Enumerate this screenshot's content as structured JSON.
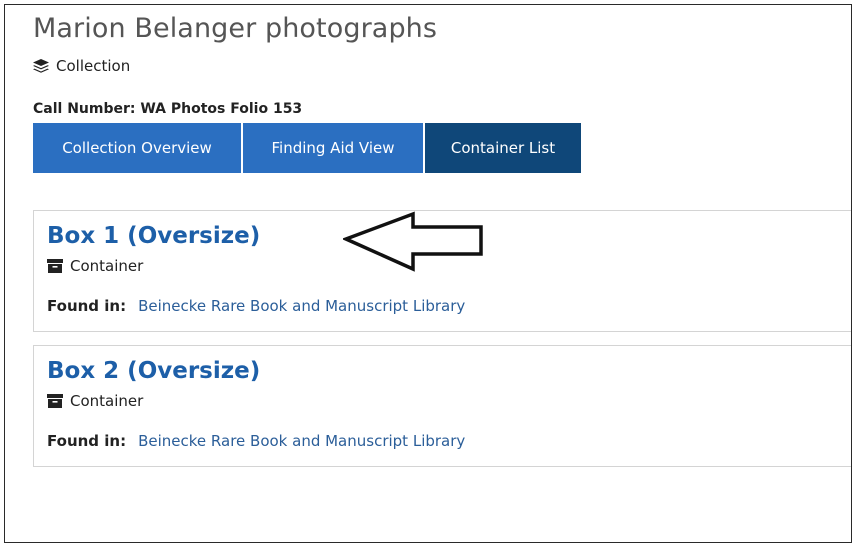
{
  "header": {
    "title": "Marion Belanger photographs",
    "type_label": "Collection",
    "type_icon": "layers-icon",
    "call_number": "Call Number: WA Photos Folio 153"
  },
  "tabs": [
    {
      "label": "Collection Overview",
      "active": false
    },
    {
      "label": "Finding Aid View",
      "active": false
    },
    {
      "label": "Container List",
      "active": true
    }
  ],
  "colors": {
    "tab_bg": "#2b6fc1",
    "tab_active_bg": "#0f4779",
    "link": "#2b5e99",
    "card_title": "#1d5fa8"
  },
  "results": [
    {
      "title": "Box 1 (Oversize)",
      "type_label": "Container",
      "type_icon": "archive-box-icon",
      "found_in_label": "Found in:",
      "found_in_value": "Beinecke Rare Book and Manuscript Library"
    },
    {
      "title": "Box 2 (Oversize)",
      "type_label": "Container",
      "type_icon": "archive-box-icon",
      "found_in_label": "Found in:",
      "found_in_value": "Beinecke Rare Book and Manuscript Library"
    }
  ],
  "annotation": {
    "icon": "left-arrow-icon"
  }
}
